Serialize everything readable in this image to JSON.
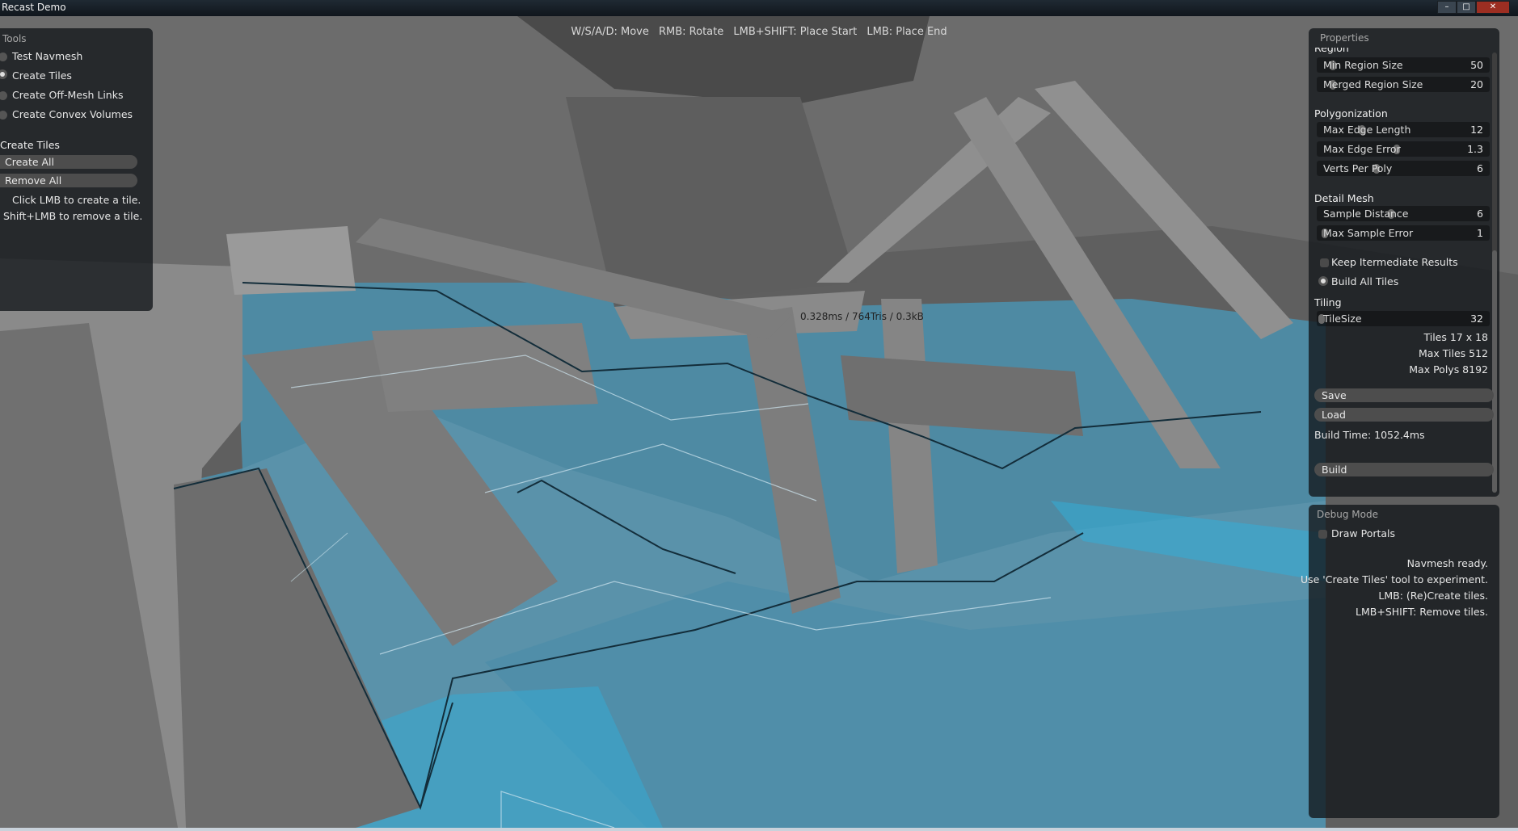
{
  "window": {
    "title": "Recast Demo"
  },
  "hint": {
    "move": "W/S/A/D: Move",
    "rotate": "RMB: Rotate",
    "start": "LMB+SHIFT: Place Start",
    "end": "LMB: Place End"
  },
  "stats": "0.328ms / 764Tris / 0.3kB",
  "tools": {
    "title": "Tools",
    "options": [
      {
        "label": "Test Navmesh",
        "selected": false
      },
      {
        "label": "Create Tiles",
        "selected": true
      },
      {
        "label": "Create Off-Mesh Links",
        "selected": false
      },
      {
        "label": "Create Convex Volumes",
        "selected": false
      }
    ],
    "section": "Create Tiles",
    "create_all": "Create All",
    "remove_all": "Remove All",
    "help1": "Click LMB to create a tile.",
    "help2": "Shift+LMB to remove a tile."
  },
  "properties": {
    "title": "Properties",
    "region_heading": "Region",
    "min_region": {
      "label": "Min Region Size",
      "value": "50"
    },
    "merged_region": {
      "label": "Merged Region Size",
      "value": "20"
    },
    "polygonization": "Polygonization",
    "max_edge_len": {
      "label": "Max Edge Length",
      "value": "12"
    },
    "max_edge_err": {
      "label": "Max Edge Error",
      "value": "1.3"
    },
    "verts_per_poly": {
      "label": "Verts Per Poly",
      "value": "6"
    },
    "detail_mesh": "Detail Mesh",
    "sample_dist": {
      "label": "Sample Distance",
      "value": "6"
    },
    "max_sample_err": {
      "label": "Max Sample Error",
      "value": "1"
    },
    "keep_intermediate": "Keep Itermediate Results",
    "build_all_tiles": "Build All Tiles",
    "tiling": "Tiling",
    "tile_size": {
      "label": "TileSize",
      "value": "32"
    },
    "tiles": "Tiles  17 x 18",
    "max_tiles": "Max Tiles  512",
    "max_polys": "Max Polys  8192",
    "save": "Save",
    "load": "Load",
    "build_time": "Build Time: 1052.4ms",
    "build": "Build"
  },
  "debug": {
    "title": "Debug Mode",
    "draw_portals": "Draw Portals",
    "msg1": "Navmesh ready.",
    "msg2": "Use 'Create Tiles' tool to experiment.",
    "msg3": "LMB: (Re)Create tiles.",
    "msg4": "LMB+SHIFT: Remove tiles."
  },
  "colors": {
    "navmesh": "#4e97b4",
    "navmesh_bright": "#2fb0dc",
    "geometry": "#7a7a7a",
    "panel": "#12161a"
  }
}
